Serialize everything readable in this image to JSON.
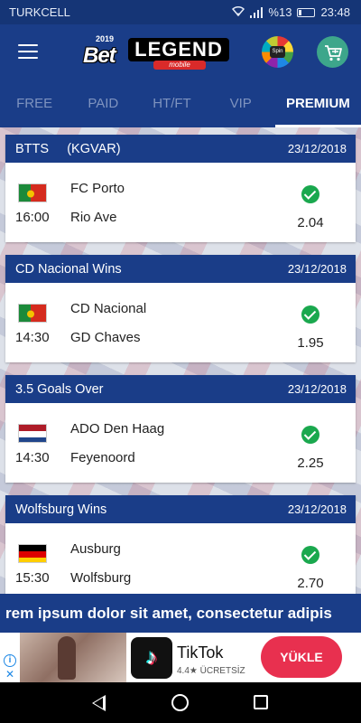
{
  "status_bar": {
    "carrier": "TURKCELL",
    "battery": "%13",
    "time": "23:48"
  },
  "header": {
    "logo_year": "2019",
    "logo_bet": "Bet",
    "logo_legend": "LEGEND",
    "logo_mobile": "mobile",
    "spin_label": "Spin"
  },
  "tabs": [
    {
      "label": "FREE",
      "active": false
    },
    {
      "label": "PAID",
      "active": false
    },
    {
      "label": "HT/FT",
      "active": false
    },
    {
      "label": "VIP",
      "active": false
    },
    {
      "label": "PREMIUM",
      "active": true
    }
  ],
  "matches": [
    {
      "title": "BTTS     (KGVAR)",
      "date": "23/12/2018",
      "flag": "portugal",
      "home": "FC Porto",
      "away": "Rio Ave",
      "time": "16:00",
      "odd": "2.04",
      "won": true
    },
    {
      "title": "CD Nacional Wins",
      "date": "23/12/2018",
      "flag": "portugal",
      "home": "CD Nacional",
      "away": "GD Chaves",
      "time": "14:30",
      "odd": "1.95",
      "won": true
    },
    {
      "title": "3.5 Goals Over",
      "date": "23/12/2018",
      "flag": "netherlands",
      "home": "ADO Den Haag",
      "away": "Feyenoord",
      "time": "14:30",
      "odd": "2.25",
      "won": true
    },
    {
      "title": "Wolfsburg Wins",
      "date": "23/12/2018",
      "flag": "germany",
      "home": "Ausburg",
      "away": "Wolfsburg",
      "time": "15:30",
      "odd": "2.70",
      "won": true
    }
  ],
  "ticker": {
    "text": "rem ipsum dolor sit amet, consectetur adipis"
  },
  "ad": {
    "app_name": "TikTok",
    "rating_text": "4.4★ ÜCRETSİZ",
    "button_label": "YÜKLE",
    "info_label": "i",
    "close_label": "✕"
  },
  "colors": {
    "primary": "#1a3d88",
    "success": "#1aa84e",
    "ad_button": "#e8304f"
  }
}
